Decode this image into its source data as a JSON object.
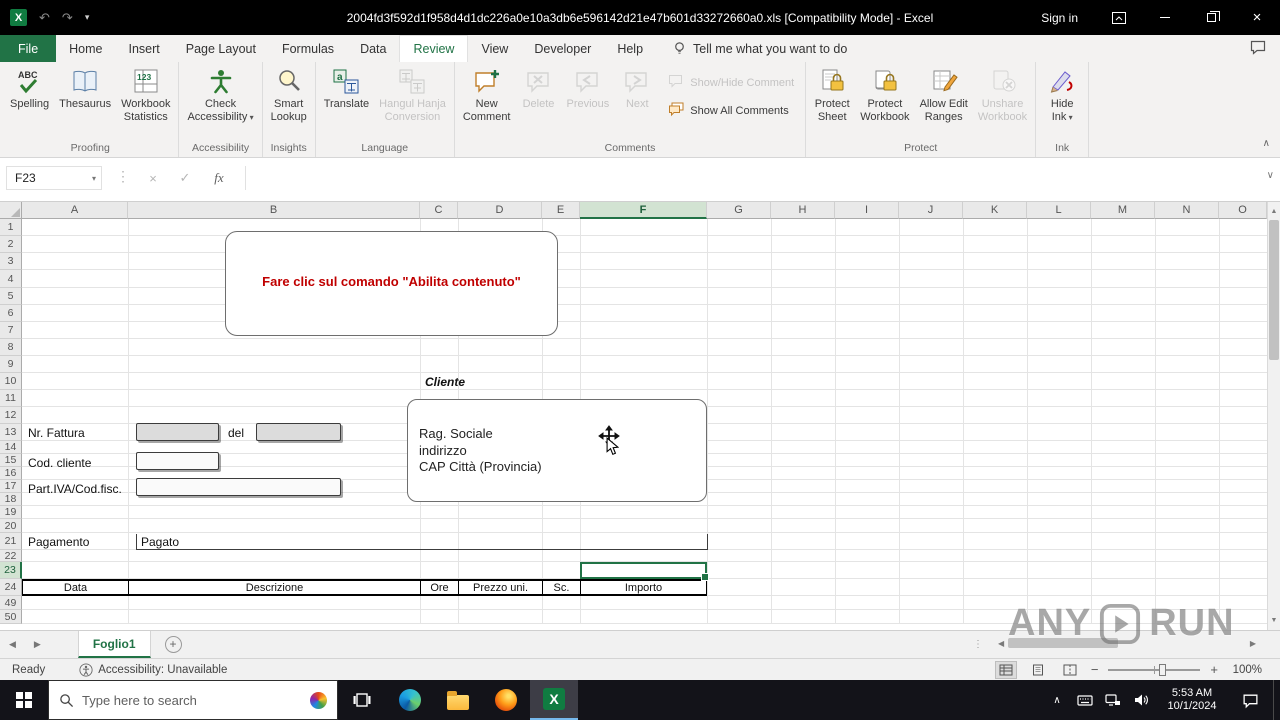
{
  "titlebar": {
    "title": "2004fd3f592d1f958d4d1dc226a0e10a3db6e596142d21e47b601d33272660a0.xls  [Compatibility Mode] -  Excel",
    "sign_in": "Sign in"
  },
  "tabs": {
    "items": [
      "File",
      "Home",
      "Insert",
      "Page Layout",
      "Formulas",
      "Data",
      "Review",
      "View",
      "Developer",
      "Help"
    ],
    "active": "Review",
    "tell_me": "Tell me what you want to do"
  },
  "ribbon": {
    "groups": [
      {
        "label": "Proofing",
        "buttons": [
          {
            "label": [
              "Spelling"
            ],
            "icon": "spelling",
            "enabled": true
          },
          {
            "label": [
              "Thesaurus"
            ],
            "icon": "thesaurus",
            "enabled": true
          },
          {
            "label": [
              "Workbook",
              "Statistics"
            ],
            "icon": "stats",
            "enabled": true
          }
        ]
      },
      {
        "label": "Accessibility",
        "buttons": [
          {
            "label": [
              "Check",
              "Accessibility"
            ],
            "icon": "accessibility",
            "enabled": true,
            "dropdown": true
          }
        ]
      },
      {
        "label": "Insights",
        "buttons": [
          {
            "label": [
              "Smart",
              "Lookup"
            ],
            "icon": "lookup",
            "enabled": true
          }
        ]
      },
      {
        "label": "Language",
        "buttons": [
          {
            "label": [
              "Translate"
            ],
            "icon": "translate",
            "enabled": true
          },
          {
            "label": [
              "Hangul Hanja",
              "Conversion"
            ],
            "icon": "hanja",
            "enabled": false
          }
        ]
      },
      {
        "label": "Comments",
        "buttons": [
          {
            "label": [
              "New",
              "Comment"
            ],
            "icon": "comment-new",
            "enabled": true
          },
          {
            "label": [
              "Delete"
            ],
            "icon": "comment-delete",
            "enabled": false
          },
          {
            "label": [
              "Previous"
            ],
            "icon": "comment-prev",
            "enabled": false
          },
          {
            "label": [
              "Next"
            ],
            "icon": "comment-next",
            "enabled": false
          }
        ],
        "stack": [
          {
            "label": "Show/Hide Comment",
            "icon": "comment-show",
            "enabled": false
          },
          {
            "label": "Show All Comments",
            "icon": "comments-all",
            "enabled": true
          }
        ]
      },
      {
        "label": "Protect",
        "buttons": [
          {
            "label": [
              "Protect",
              "Sheet"
            ],
            "icon": "protect-sheet",
            "enabled": true
          },
          {
            "label": [
              "Protect",
              "Workbook"
            ],
            "icon": "protect-workbook",
            "enabled": true
          },
          {
            "label": [
              "Allow Edit",
              "Ranges"
            ],
            "icon": "edit-ranges",
            "enabled": true
          },
          {
            "label": [
              "Unshare",
              "Workbook"
            ],
            "icon": "unshare",
            "enabled": false
          }
        ]
      },
      {
        "label": "Ink",
        "buttons": [
          {
            "label": [
              "Hide",
              "Ink"
            ],
            "icon": "hide-ink",
            "enabled": true,
            "dropdown": true
          }
        ]
      }
    ]
  },
  "formula_bar": {
    "name_box": "F23",
    "fx": "fx"
  },
  "grid": {
    "columns": [
      "A",
      "B",
      "C",
      "D",
      "E",
      "F",
      "G",
      "H",
      "I",
      "J",
      "K",
      "L",
      "M",
      "N",
      "O"
    ],
    "rows": [
      1,
      2,
      3,
      4,
      5,
      6,
      7,
      8,
      9,
      10,
      11,
      12,
      13,
      14,
      15,
      16,
      17,
      18,
      19,
      20,
      21,
      22,
      23,
      24,
      49,
      50
    ],
    "selected_column": "F",
    "selected_row": 23,
    "selected_cell": "F23"
  },
  "sheet": {
    "notice_box": "Fare clic sul comando \"Abilita contenuto\"",
    "cliente_label": "Cliente",
    "cliente_box": [
      "Rag. Sociale",
      "indirizzo",
      "CAP Città (Provincia)"
    ],
    "fields": {
      "nr_fattura": "Nr. Fattura",
      "del": "del",
      "cod_cliente": "Cod. cliente",
      "part_iva": "Part.IVA/Cod.fisc.",
      "pagamento": "Pagamento",
      "pagato": "Pagato"
    },
    "table_headers": [
      "Data",
      "Descrizione",
      "Ore",
      "Prezzo uni.",
      "Sc.",
      "Importo"
    ]
  },
  "sheet_tabs": {
    "active": "Foglio1"
  },
  "status_bar": {
    "ready": "Ready",
    "accessibility": "Accessibility: Unavailable",
    "zoom_level": "100%"
  },
  "watermark": {
    "left": "ANY",
    "right": "RUN"
  },
  "taskbar": {
    "search_placeholder": "Type here to search",
    "time": "5:53 AM",
    "date": "10/1/2024"
  }
}
